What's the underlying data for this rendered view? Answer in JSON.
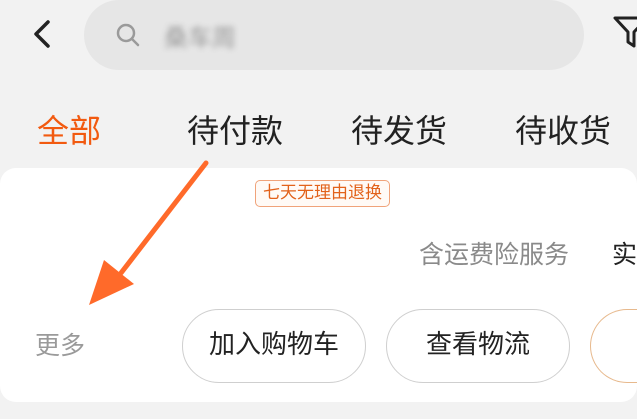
{
  "search": {
    "text": "桑车周"
  },
  "tabs": [
    {
      "label": "全部"
    },
    {
      "label": "待付款"
    },
    {
      "label": "待发货"
    },
    {
      "label": "待收货"
    }
  ],
  "order": {
    "promo_tag": "七天无理由退换",
    "service_text": "含运费险服务",
    "service_extra": "实",
    "more_label": "更多",
    "buttons": [
      {
        "label": "加入购物车"
      },
      {
        "label": "查看物流"
      }
    ]
  },
  "colors": {
    "accent": "#f25a10",
    "annotation_arrow": "#ff6a2a"
  }
}
